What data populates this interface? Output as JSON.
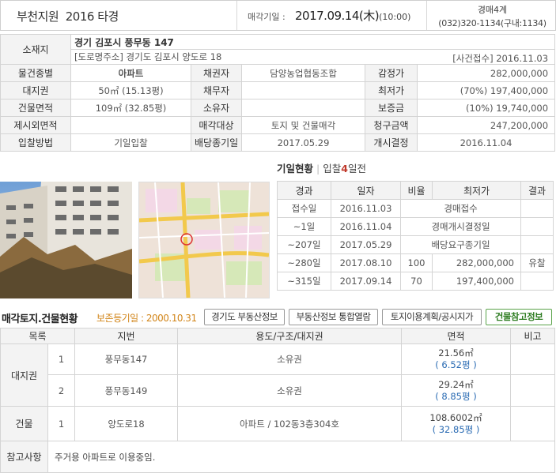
{
  "header": {
    "court": "부천지원",
    "case_no": "2016 타경",
    "auction_date_label": "매각기일 :",
    "auction_date": "2017.09.14(木)",
    "auction_time": "(10:00)",
    "dept": "경매4계",
    "phone": "(032)320-1134(구내:1134)"
  },
  "info": {
    "location_label": "소재지",
    "address": "경기 김포시 풍무동 147",
    "road_address": "[도로명주소] 경기도 김포시 양도로 18",
    "case_received": "[사건접수] 2016.11.03",
    "rows": [
      [
        "물건종별",
        "아파트",
        "채권자",
        "담양농업협동조합",
        "감정가",
        "282,000,000"
      ],
      [
        "대지권",
        "50㎡ (15.13평)",
        "채무자",
        "",
        "최저가",
        "(70%) 197,400,000"
      ],
      [
        "건물면적",
        "109㎡ (32.85평)",
        "소유자",
        "",
        "보증금",
        "(10%) 19,740,000"
      ],
      [
        "제시외면적",
        "",
        "매각대상",
        "토지 및 건물매각",
        "청구금액",
        "247,200,000"
      ],
      [
        "입찰방법",
        "기일입찰",
        "배당종기일",
        "2017.05.29",
        "개시결정",
        "2016.11.04"
      ]
    ]
  },
  "bid_status": {
    "title": "기일현황",
    "sep": "|",
    "count_prefix": "입찰",
    "count": "4",
    "count_suffix": "일전",
    "headers": [
      "경과",
      "일자",
      "비율",
      "최저가",
      "결과"
    ],
    "rows": [
      {
        "elapsed": "접수일",
        "date": "2016.11.03",
        "ratio": "",
        "price": "경매접수",
        "result": ""
      },
      {
        "elapsed": "~1일",
        "date": "2016.11.04",
        "ratio": "",
        "price": "경매개시결정일",
        "result": ""
      },
      {
        "elapsed": "~207일",
        "date": "2017.05.29",
        "ratio": "",
        "price": "배당요구종기일",
        "result": ""
      },
      {
        "elapsed": "~280일",
        "date": "2017.08.10",
        "ratio": "100",
        "price": "282,000,000",
        "result": "유찰"
      },
      {
        "elapsed": "~315일",
        "date": "2017.09.14",
        "ratio": "70",
        "price": "197,400,000",
        "result": ""
      }
    ]
  },
  "land": {
    "title": "매각토지.건물현황",
    "preserve_date": "보존등기일 : 2000.10.31",
    "buttons": [
      "경기도 부동산정보",
      "부동산정보 통합열람",
      "토지이용계획/공시지가",
      "건물참고정보"
    ],
    "headers": [
      "목록",
      "지번",
      "용도/구조/대지권",
      "면적",
      "비고"
    ],
    "group_land": "대지권",
    "group_building": "건물",
    "rows": [
      {
        "no": "1",
        "lot": "풍무동147",
        "use": "소유권",
        "area": "21.56㎡",
        "pyeong": "( 6.52평 )"
      },
      {
        "no": "2",
        "lot": "풍무동149",
        "use": "소유권",
        "area": "29.24㎡",
        "pyeong": "( 8.85평 )"
      },
      {
        "no": "1",
        "lot": "양도로18",
        "use": "아파트 / 102동3층304호",
        "area": "108.6002㎡",
        "pyeong": "( 32.85평 )"
      }
    ],
    "note_label": "참고사항",
    "note": "주거용 아파트로 이용중임."
  },
  "colors": {
    "accent_red": "#c0392b",
    "accent_blue": "#2a6bb3",
    "accent_orange": "#d2861b",
    "accent_green": "#2f7d22"
  }
}
